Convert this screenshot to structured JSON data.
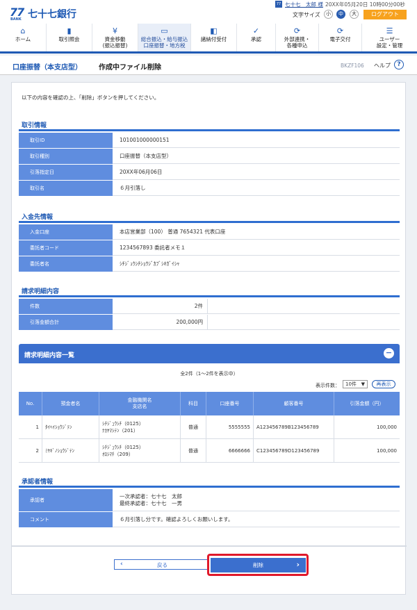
{
  "header": {
    "logo_num": "77",
    "logo_bank": "BANK",
    "logo_name": "七十七銀行",
    "user_badge": "77",
    "user_name": "七十七　太郎 様",
    "last_login": "20XX年05月20日 10時00分00秒",
    "font_size_label": "文字サイズ",
    "font_small": "小",
    "font_medium": "中",
    "font_large": "大",
    "logout": "ログアウト"
  },
  "nav": {
    "items": [
      {
        "label": "ホーム",
        "icon": "home-icon"
      },
      {
        "label": "取引照会",
        "icon": "document-icon"
      },
      {
        "label": "資金移動\n(振込振替)",
        "icon": "yen-transfer-icon"
      },
      {
        "label": "総合振込・給与振込\n口座振替・地方税",
        "icon": "payment-icon"
      },
      {
        "label": "諸納付受付",
        "icon": "tax-icon"
      },
      {
        "label": "承認",
        "icon": "approve-icon"
      },
      {
        "label": "外部連携・\n各種申込",
        "icon": "link-icon"
      },
      {
        "label": "電子交付",
        "icon": "e-delivery-icon"
      },
      {
        "label": "ユーザー\n設定・管理",
        "icon": "user-settings-icon"
      }
    ]
  },
  "title": {
    "category": "口座振替（本支店型）",
    "page": "作成中ファイル削除",
    "screen_id": "BKZF106",
    "help": "ヘルプ",
    "help_icon": "?"
  },
  "notice": "以下の内容を確認の上、「削除」ボタンを押してください。",
  "transaction": {
    "heading": "取引情報",
    "rows": [
      {
        "label": "取引ID",
        "value": "101001000000151"
      },
      {
        "label": "取引種別",
        "value": "口座振替（本支店型）"
      },
      {
        "label": "引落指定日",
        "value": "20XX年06月06日"
      },
      {
        "label": "取引名",
        "value": "６月引落し"
      }
    ]
  },
  "deposit": {
    "heading": "入金先情報",
    "rows": [
      {
        "label": "入金口座",
        "value": "本店営業部（100） 普通 7654321 代表口座"
      },
      {
        "label": "委託者コード",
        "value": "1234567893 委託者メモ１"
      },
      {
        "label": "委託者名",
        "value": "ｼﾁｼﾞｭｳｼﾁｼｮｳｼﾞｶﾌﾞｼｷｶﾞｲｼｬ"
      }
    ]
  },
  "billing": {
    "heading": "請求明細内容",
    "rows": [
      {
        "label": "件数",
        "value": "2件"
      },
      {
        "label": "引落金額合計",
        "value": "200,000円"
      }
    ]
  },
  "billing_list": {
    "heading": "請求明細内容一覧",
    "collapse": "−",
    "count_text": "全2件（1～2件を表示中）",
    "display_count_label": "表示件数：",
    "display_count_value": "10件",
    "redisplay": "再表示",
    "columns": [
      "No.",
      "預金者名",
      "金融機関名\n支店名",
      "科目",
      "口座番号",
      "顧客番号",
      "引落金額（円）"
    ],
    "rows": [
      {
        "no": "1",
        "name": "ﾀｲﾍｲｼｮｳｼﾞﾃﾝ",
        "bank": "ｼﾁｼﾞｭｳｼﾁ（0125）\nﾅｶﾔﾏｼﾃﾝ（201）",
        "type": "普通",
        "account": "5555555",
        "customer": "A123456789B123456789",
        "amount": "100,000"
      },
      {
        "no": "2",
        "name": "ﾐﾔｷﾞﾉｼｮｳｼﾞﾃﾝ",
        "bank": "ｼﾁｼﾞｭｳｼﾁ（0125）\nｵﾛｼﾏﾁ（209）",
        "type": "普通",
        "account": "6666666",
        "customer": "C123456789D123456789",
        "amount": "100,000"
      }
    ]
  },
  "approver": {
    "heading": "承認者情報",
    "rows": [
      {
        "label": "承認者",
        "value": "一次承認者：七十七　太郎\n最終承認者：七十七　一男"
      },
      {
        "label": "コメント",
        "value": "６月引落し分です。確認よろしくお願いします。"
      }
    ]
  },
  "buttons": {
    "back": "戻る",
    "delete": "削除"
  },
  "colors": {
    "primary": "#1f5ab4",
    "label_bg": "#5f8ddf",
    "logout": "#f7a21e",
    "focus": "#e0192b"
  }
}
